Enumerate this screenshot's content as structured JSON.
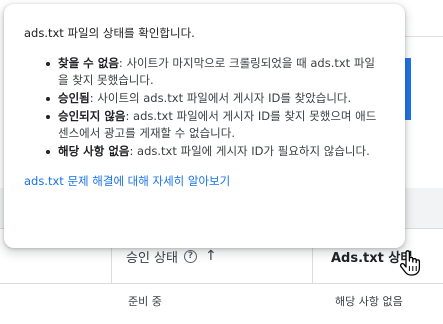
{
  "tooltip": {
    "title": "ads.txt 파일의 상태를 확인합니다.",
    "items": [
      {
        "term": "찾을 수 없음",
        "sep": ": ",
        "desc": "사이트가 마지막으로 크롤링되었을 때 ads.txt 파일을 찾지 못했습니다."
      },
      {
        "term": "승인됨",
        "sep": ": ",
        "desc": "사이트의 ads.txt 파일에서 게시자 ID를 찾았습니다."
      },
      {
        "term": "승인되지 않음",
        "sep": ": ",
        "desc": "ads.txt 파일에서 게시자 ID를 찾지 못했으며 애드센스에서 광고를 게재할 수 없습니다."
      },
      {
        "term": "해당 사항 없음",
        "sep": ": ",
        "desc": "ads.txt 파일에 게시자 ID가 필요하지 않습니다."
      }
    ],
    "link_label": "ads.txt 문제 해결에 대해 자세히 알아보기"
  },
  "table": {
    "headers": {
      "approval_status": "승인 상태",
      "help_icon_glyph": "?",
      "sort_icon_glyph": "↑",
      "ads_txt_status": "Ads.txt 상태"
    },
    "rows": [
      {
        "approval_status": "준비 중",
        "ads_txt_status": "해당 사항 없음"
      }
    ]
  },
  "colors": {
    "link": "#1a73e8",
    "accent_bar": "#1a73e8",
    "text": "#202124",
    "border": "#dadce0"
  }
}
